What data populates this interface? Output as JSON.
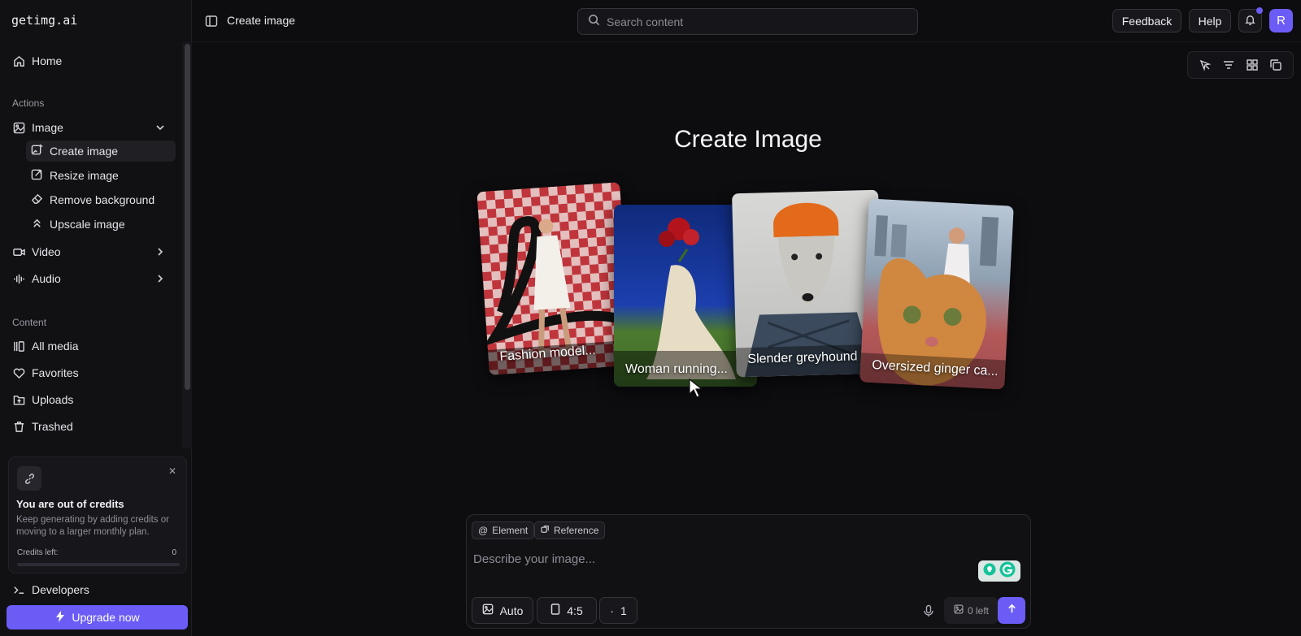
{
  "app": {
    "logo": "getimg.ai"
  },
  "header": {
    "breadcrumb": "Create image",
    "search_placeholder": "Search content",
    "feedback_label": "Feedback",
    "help_label": "Help",
    "avatar_initial": "R"
  },
  "sidebar": {
    "home": "Home",
    "actions_label": "Actions",
    "image": "Image",
    "image_items": [
      "Create image",
      "Resize image",
      "Remove background",
      "Upscale image"
    ],
    "video": "Video",
    "audio": "Audio",
    "content_label": "Content",
    "content_items": [
      "All media",
      "Favorites",
      "Uploads",
      "Trashed"
    ],
    "developers": "Developers",
    "upgrade_label": "Upgrade now"
  },
  "credits_card": {
    "title": "You are out of credits",
    "description": "Keep generating by adding credits or moving to a larger monthly plan.",
    "credits_left_label": "Credits left:",
    "credits_left_value": "0",
    "progress_fraction": 0
  },
  "main": {
    "heading": "Create Image",
    "examples": [
      {
        "caption": "Fashion model..."
      },
      {
        "caption": "Woman running..."
      },
      {
        "caption": "Slender greyhound"
      },
      {
        "caption": "Oversized ginger ca..."
      }
    ]
  },
  "prompt": {
    "element_chip": "Element",
    "reference_chip": "Reference",
    "placeholder": "Describe your image...",
    "mode_label": "Auto",
    "aspect_label": "4:5",
    "count_label": "1",
    "left_label": "0 left"
  },
  "colors": {
    "accent": "#6b5cf6",
    "background": "#0d0d10",
    "sidebar": "#111114"
  }
}
